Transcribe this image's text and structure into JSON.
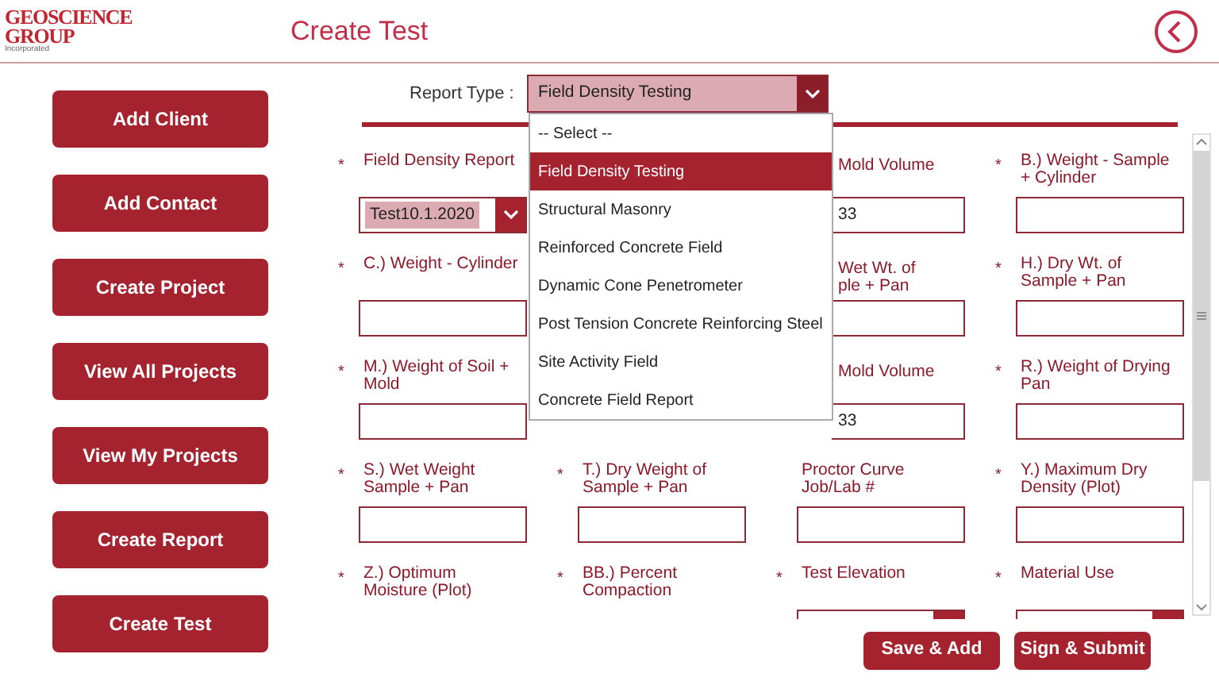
{
  "header": {
    "logo": {
      "line1": "GEOSCIENCE",
      "line2": "GROUP",
      "tagline": "Incorporated"
    },
    "title": "Create Test"
  },
  "nav": [
    {
      "label": "Add Client"
    },
    {
      "label": "Add Contact"
    },
    {
      "label": "Create Project"
    },
    {
      "label": "View All Projects"
    },
    {
      "label": "View My Projects"
    },
    {
      "label": "Create Report"
    },
    {
      "label": "Create Test"
    }
  ],
  "report_type": {
    "label": "Report Type :",
    "value": "Field Density Testing",
    "expanded": true,
    "options": [
      {
        "label": "-- Select --",
        "selected": false
      },
      {
        "label": "Field Density Testing",
        "selected": true
      },
      {
        "label": "Structural Masonry",
        "selected": false
      },
      {
        "label": "Reinforced Concrete Field",
        "selected": false
      },
      {
        "label": "Dynamic Cone Penetrometer",
        "selected": false
      },
      {
        "label": "Post Tension Concrete Reinforcing Steel",
        "selected": false
      },
      {
        "label": "Site Activity Field",
        "selected": false
      },
      {
        "label": "Concrete Field Report",
        "selected": false
      }
    ]
  },
  "rows": [
    {
      "cells": [
        {
          "kind": "select",
          "mark": "*",
          "label": "Field Density Report",
          "value": "Test10.1.2020"
        },
        {
          "kind": "partial",
          "label": "Mold Volume",
          "value": "33"
        },
        {
          "kind": "text",
          "mark": "*",
          "label": "B.) Weight - Sample + Cylinder"
        }
      ]
    },
    {
      "cells": [
        {
          "kind": "text",
          "mark": "*",
          "label": "C.) Weight - Cylinder"
        },
        {
          "kind": "partial",
          "label": "Wet Wt. of\nple + Pan"
        },
        {
          "kind": "text",
          "mark": "*",
          "label": "H.) Dry Wt. of Sample + Pan"
        }
      ]
    },
    {
      "cells": [
        {
          "kind": "text",
          "mark": "*",
          "label": "M.) Weight of Soil + Mold"
        },
        {
          "kind": "partial",
          "label": "Mold Volume",
          "value": "33"
        },
        {
          "kind": "text",
          "mark": "*",
          "label": "R.) Weight of Drying Pan"
        }
      ]
    },
    {
      "cells": [
        {
          "kind": "text",
          "mark": "*",
          "label": "S.) Wet Weight Sample + Pan"
        },
        {
          "kind": "text",
          "mark": "*",
          "label": "T.) Dry Weight of Sample + Pan"
        },
        {
          "kind": "text",
          "label": "Proctor Curve Job/Lab #"
        },
        {
          "kind": "text",
          "mark": "*",
          "label": "Y.) Maximum Dry Density (Plot)"
        }
      ]
    },
    {
      "cells": [
        {
          "kind": "label",
          "mark": "*",
          "label": "Z.) Optimum Moisture (Plot)"
        },
        {
          "kind": "label",
          "mark": "*",
          "label": "BB.) Percent Compaction"
        },
        {
          "kind": "select_cut",
          "mark": "*",
          "label": "Test Elevation"
        },
        {
          "kind": "select_cut",
          "mark": "*",
          "label": "Material Use"
        }
      ]
    }
  ],
  "actions": [
    {
      "label": "Save & Add"
    },
    {
      "label": "Sign & Submit"
    }
  ]
}
